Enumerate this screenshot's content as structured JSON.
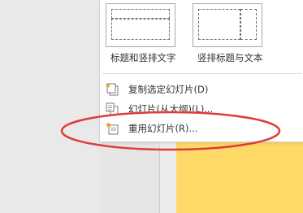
{
  "layouts": [
    {
      "label": "标题和竖排文字"
    },
    {
      "label": "竖排标题与文本"
    }
  ],
  "menu_items": [
    {
      "label": "复制选定幻灯片(D)",
      "icon": "duplicate-slides-icon"
    },
    {
      "label": "幻灯片(从大纲)(L)...",
      "icon": "slides-from-outline-icon"
    },
    {
      "label": "重用幻灯片(R)...",
      "icon": "reuse-slides-icon"
    }
  ],
  "colors": {
    "slide_background": "#fed968",
    "annotation_ellipse": "#e03a3a",
    "icon_star": "#e8a317"
  }
}
